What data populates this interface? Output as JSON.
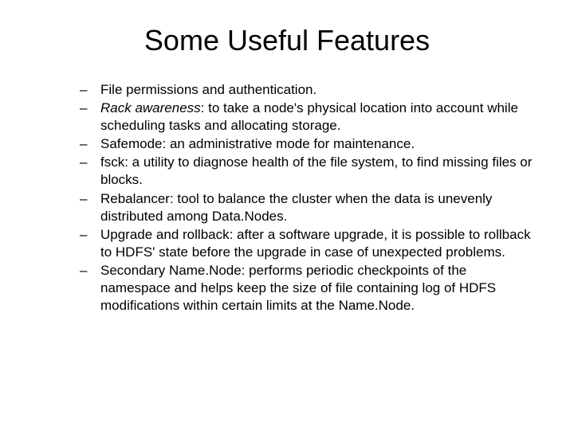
{
  "title": "Some Useful Features",
  "bullets": [
    {
      "prefix": "",
      "emphasis": "",
      "text": "File permissions and authentication."
    },
    {
      "prefix": "",
      "emphasis": "Rack awareness",
      "text": ": to take a node's physical location into account while scheduling tasks and allocating storage."
    },
    {
      "prefix": "Safemode: an administrative mode for maintenance.",
      "emphasis": "",
      "text": ""
    },
    {
      "prefix": "fsck: a utility to diagnose health of the file system, to find missing files or blocks.",
      "emphasis": "",
      "text": ""
    },
    {
      "prefix": "Rebalancer: tool to balance the cluster when the data is unevenly distributed among Data.Nodes.",
      "emphasis": "",
      "text": ""
    },
    {
      "prefix": "Upgrade and rollback: after a software upgrade, it is possible to rollback to HDFS' state before the upgrade in case of unexpected problems.",
      "emphasis": "",
      "text": ""
    },
    {
      "prefix": "Secondary Name.Node: performs periodic checkpoints of the namespace and helps keep the size of file containing log of HDFS modifications within certain limits at the Name.Node.",
      "emphasis": "",
      "text": ""
    }
  ]
}
